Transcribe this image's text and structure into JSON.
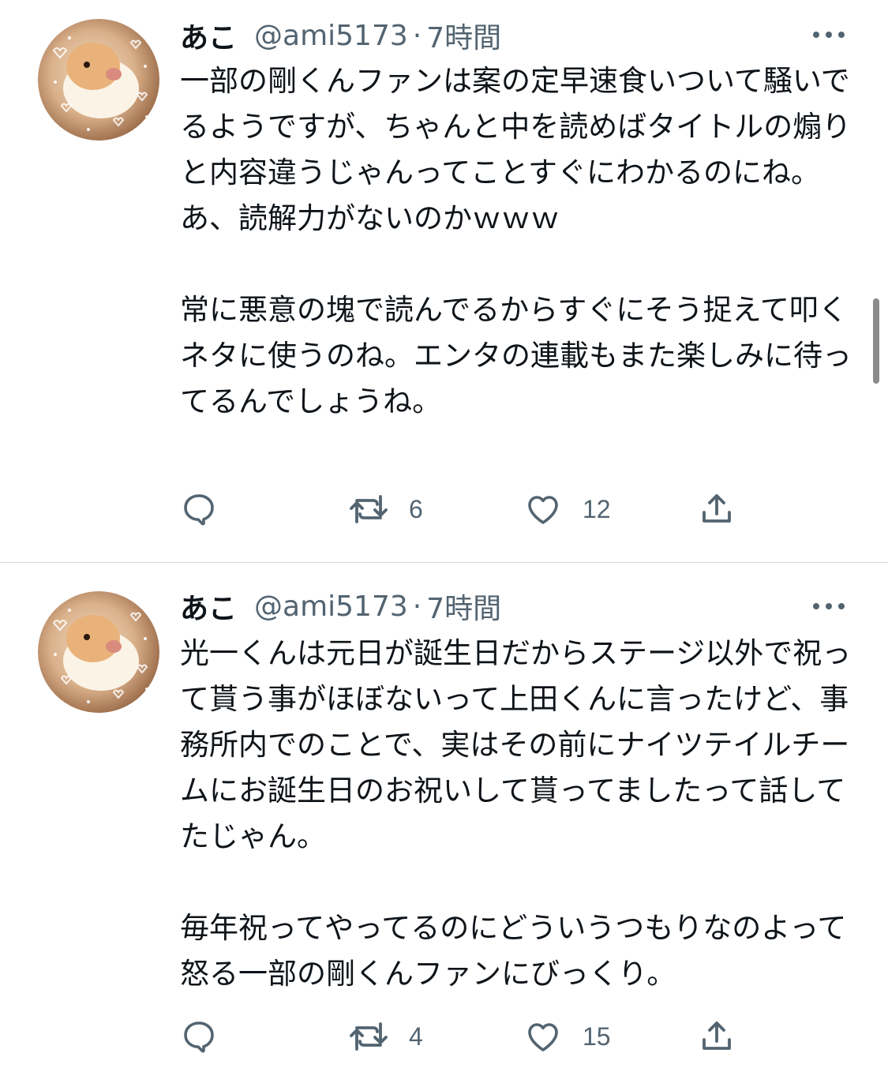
{
  "tweets": [
    {
      "author_name": "あこ",
      "handle": "@ami5173",
      "separator": "·",
      "time": "7時間",
      "text": "一部の剛くんファンは案の定早速食いついて騒いでるようですが、ちゃんと中を読めばタイトルの煽りと内容違うじゃんってことすぐにわかるのにね。\nあ、読解力がないのかｗｗｗ\n\n常に悪意の塊で読んでるからすぐにそう捉えて叩くネタに使うのね。エンタの連載もまた楽しみに待ってるんでしょうね。",
      "actions": {
        "reply_icon": "reply-icon",
        "retweet_icon": "retweet-icon",
        "retweet_count": "6",
        "like_icon": "like-icon",
        "like_count": "12",
        "share_icon": "share-icon"
      }
    },
    {
      "author_name": "あこ",
      "handle": "@ami5173",
      "separator": "·",
      "time": "7時間",
      "text": "光一くんは元日が誕生日だからステージ以外で祝って貰う事がほぼないって上田くんに言ったけど、事務所内でのことで、実はその前にナイツテイルチームにお誕生日のお祝いして貰ってましたって話してたじゃん。\n\n毎年祝ってやってるのにどういうつもりなのよって怒る一部の剛くんファンにびっくり。",
      "actions": {
        "reply_icon": "reply-icon",
        "retweet_icon": "retweet-icon",
        "retweet_count": "4",
        "like_icon": "like-icon",
        "like_count": "15",
        "share_icon": "share-icon"
      }
    }
  ],
  "colors": {
    "text": "#0f1419",
    "secondary": "#536471",
    "divider": "#cfd9de",
    "icon": "#536471"
  }
}
